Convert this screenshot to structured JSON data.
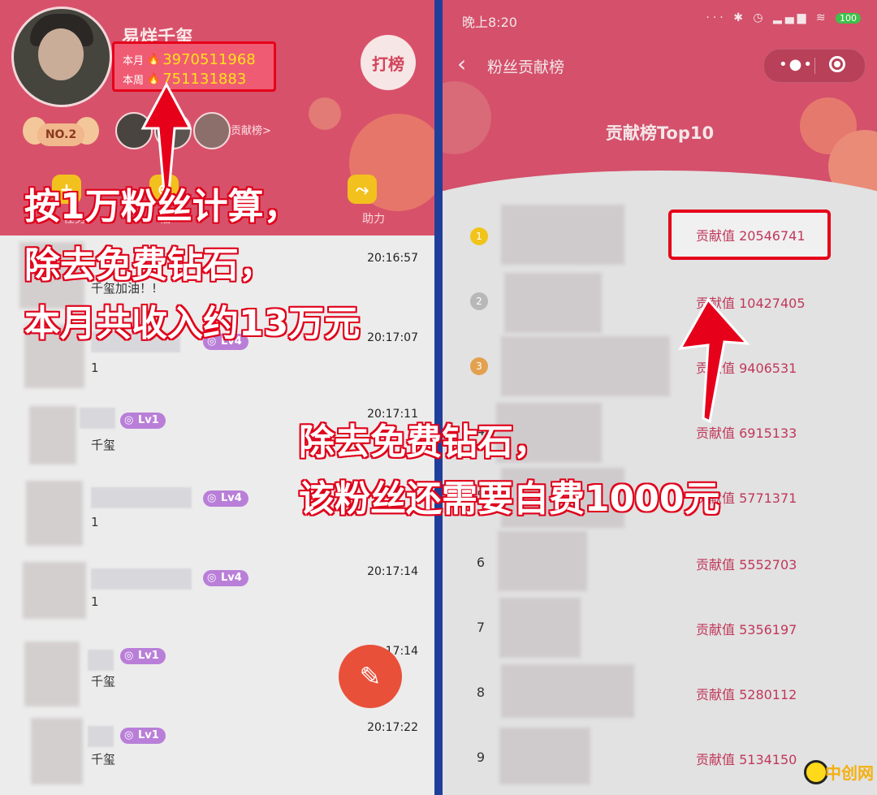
{
  "left": {
    "name": "易烊千玺",
    "month_label": "本月",
    "month_value": "3970511968",
    "week_label": "本周",
    "week_value": "751131883",
    "rank_button": "打榜",
    "rank_badge": "NO.2",
    "contrib_link": "贡献榜>",
    "actions": [
      "任务",
      "福",
      "",
      "助力"
    ],
    "feed": [
      {
        "time": "20:16:57",
        "message": "千玺加油！!",
        "level": ""
      },
      {
        "time": "20:17:07",
        "message": "1",
        "level": "Lv4"
      },
      {
        "time": "20:17:11",
        "message": "千玺",
        "level": "Lv1"
      },
      {
        "time": "",
        "message": "1",
        "level": "Lv4"
      },
      {
        "time": "20:17:14",
        "message": "1",
        "level": "Lv4"
      },
      {
        "time": "20:17:14",
        "message": "千玺",
        "level": "Lv1"
      },
      {
        "time": "20:17:22",
        "message": "千玺",
        "level": "Lv1"
      }
    ],
    "fab_icon": "pencil-icon"
  },
  "right": {
    "status_time": "晚上8:20",
    "battery": "100",
    "title": "粉丝贡献榜",
    "subtitle": "贡献榜Top10",
    "rows": [
      {
        "rank": "1",
        "score": "贡献值 20546741"
      },
      {
        "rank": "2",
        "score": "贡献值 10427405"
      },
      {
        "rank": "3",
        "score": "贡献值 9406531"
      },
      {
        "rank": "4",
        "score": "贡献值 6915133"
      },
      {
        "rank": "5",
        "score": "贡献值 5771371"
      },
      {
        "rank": "6",
        "score": "贡献值 5552703"
      },
      {
        "rank": "7",
        "score": "贡献值 5356197"
      },
      {
        "rank": "8",
        "score": "贡献值 5280112"
      },
      {
        "rank": "9",
        "score": "贡献值 5134150"
      }
    ]
  },
  "annotations": {
    "left_line1": "按1万粉丝计算，",
    "left_line2": "除去免费钻石，",
    "left_line3": "本月共收入约13万元",
    "right_line1": "除去免费钻石，",
    "right_line2": "该粉丝还需要自费1000元"
  },
  "watermark": "中创网",
  "colors": {
    "accent_red": "#e6001a",
    "header_pink": "#d8516a",
    "score_text": "#c0385a"
  }
}
